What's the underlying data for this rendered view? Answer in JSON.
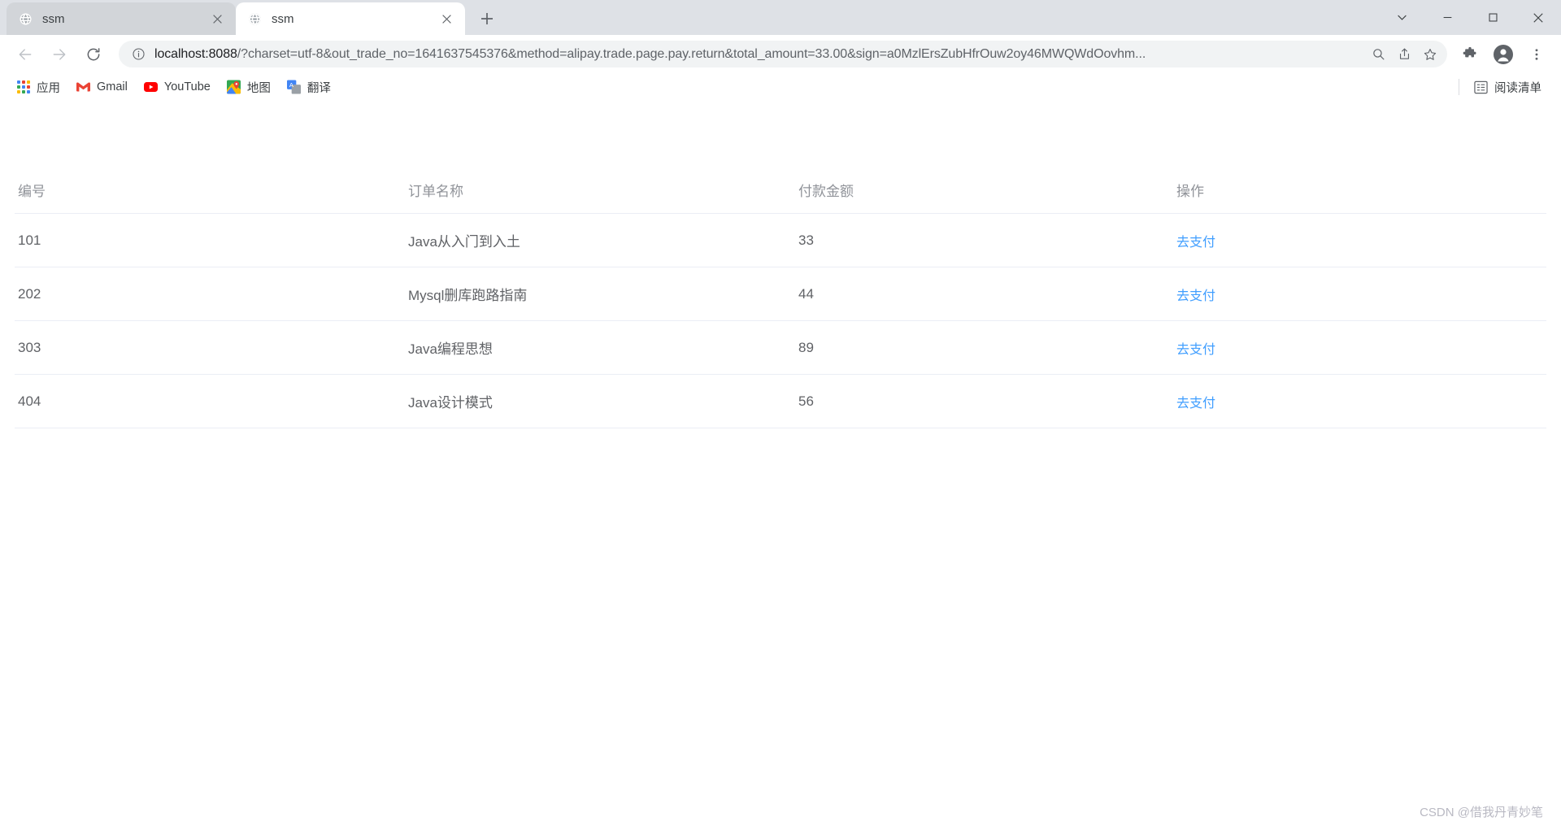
{
  "window": {
    "controls": {
      "list_label": "tab-search",
      "minimize_label": "minimize",
      "maximize_label": "maximize",
      "close_label": "close"
    }
  },
  "tabs": [
    {
      "title": "ssm",
      "favicon": "globe-icon",
      "active": false
    },
    {
      "title": "ssm",
      "favicon": "globe-icon",
      "active": true
    }
  ],
  "newtab": {
    "label": "+"
  },
  "toolbar": {
    "back_label": "back",
    "forward_label": "forward",
    "reload_label": "reload",
    "omnibox": {
      "host": "localhost:8088",
      "rest": "/?charset=utf-8&out_trade_no=1641637545376&method=alipay.trade.page.pay.return&total_amount=33.00&sign=a0MzlErsZubHfrOuw2oy46MWQWdOovhm...",
      "full_url": "localhost:8088/?charset=utf-8&out_trade_no=1641637545376&method=alipay.trade.page.pay.return&total_amount=33.00&sign=a0MzlErsZubHfrOuw2oy46MWQWdOovhm...",
      "info_icon": "info-circle-icon",
      "zoom_icon": "search-icon",
      "share_icon": "share-icon",
      "bookmark_icon": "star-icon"
    },
    "extensions_icon": "puzzle-icon",
    "profile_icon": "avatar-icon",
    "menu_icon": "three-dots-icon"
  },
  "bookmarks": {
    "items": [
      {
        "label": "应用",
        "icon": "apps-grid-icon"
      },
      {
        "label": "Gmail",
        "icon": "gmail-icon"
      },
      {
        "label": "YouTube",
        "icon": "youtube-icon"
      },
      {
        "label": "地图",
        "icon": "maps-pin-icon"
      },
      {
        "label": "翻译",
        "icon": "translate-icon"
      }
    ],
    "reading_list": {
      "label": "阅读清单",
      "icon": "reading-list-icon"
    }
  },
  "page": {
    "table": {
      "headers": [
        "编号",
        "订单名称",
        "付款金额",
        "操作"
      ],
      "rows": [
        {
          "id": "101",
          "name": "Java从入门到入土",
          "amount": "33",
          "action": "去支付"
        },
        {
          "id": "202",
          "name": "Mysql删库跑路指南",
          "amount": "44",
          "action": "去支付"
        },
        {
          "id": "303",
          "name": "Java编程思想",
          "amount": "89",
          "action": "去支付"
        },
        {
          "id": "404",
          "name": "Java设计模式",
          "amount": "56",
          "action": "去支付"
        }
      ]
    },
    "watermark": "CSDN @借我丹青妙笔"
  },
  "colors": {
    "link": "#409eff",
    "header_text": "#909399",
    "cell_text": "#606266",
    "tabstrip_bg": "#dee1e6",
    "omnibox_bg": "#f1f3f4"
  }
}
